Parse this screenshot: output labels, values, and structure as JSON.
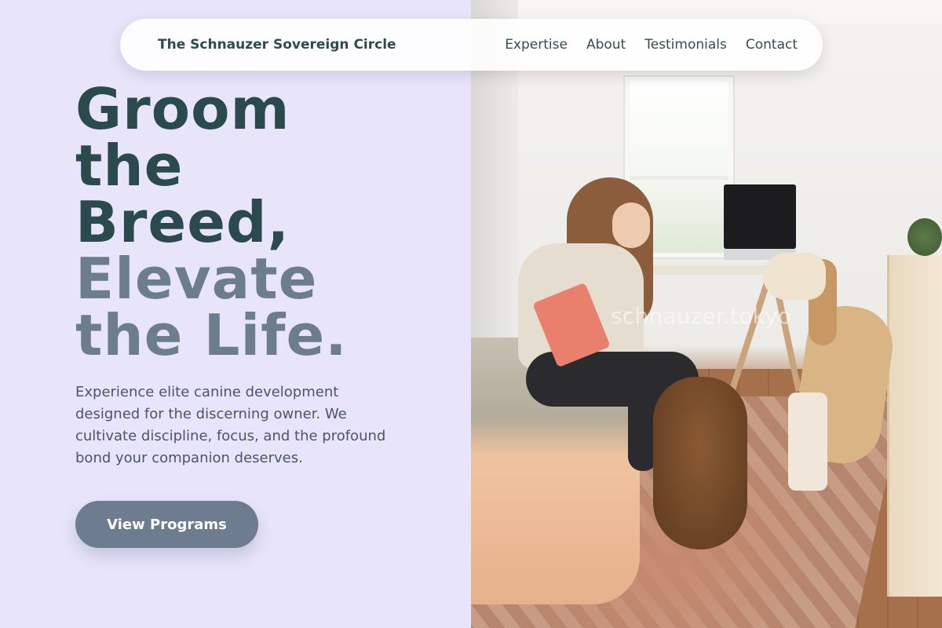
{
  "header": {
    "brand": "The Schnauzer Sovereign Circle",
    "nav": [
      "Expertise",
      "About",
      "Testimonials",
      "Contact"
    ]
  },
  "hero": {
    "headline_dark": [
      "Groom",
      "the",
      "Breed,"
    ],
    "headline_muted": [
      "Elevate",
      "the Life."
    ],
    "description": "Experience elite canine development designed for the discerning owner. We cultivate discipline, focus, and the profound bond your companion deserves.",
    "cta_label": "View Programs"
  },
  "image": {
    "watermark": "schnauzer.tokyo"
  },
  "colors": {
    "background": "#e8e5fa",
    "heading_dark": "#2b4a4d",
    "heading_muted": "#6c7d8d",
    "button": "#6d7c8e"
  }
}
